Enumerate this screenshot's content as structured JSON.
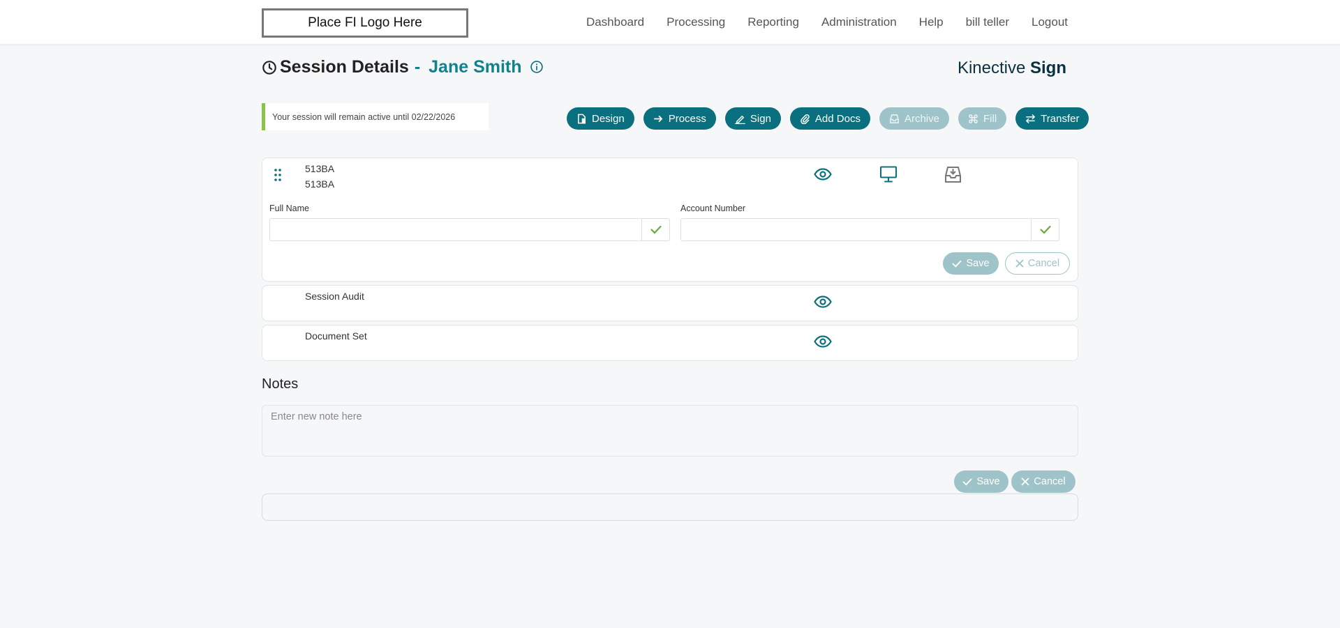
{
  "header": {
    "logo_text": "Place FI Logo Here",
    "nav": [
      "Dashboard",
      "Processing",
      "Reporting",
      "Administration",
      "Help",
      "bill teller",
      "Logout"
    ]
  },
  "title": {
    "label": "Session Details",
    "dash": "-",
    "name": "Jane Smith"
  },
  "brand": {
    "regular": "Kinective",
    "bold": "Sign"
  },
  "session_notice": "Your session will remain active until 02/22/2026",
  "actions": [
    {
      "label": "Design",
      "icon": "document-icon",
      "enabled": true
    },
    {
      "label": "Process",
      "icon": "arrow-right-icon",
      "enabled": true
    },
    {
      "label": "Sign",
      "icon": "pen-icon",
      "enabled": true
    },
    {
      "label": "Add Docs",
      "icon": "paperclip-icon",
      "enabled": true
    },
    {
      "label": "Archive",
      "icon": "archive-icon",
      "enabled": false
    },
    {
      "label": "Fill",
      "icon": "command-icon",
      "enabled": false
    },
    {
      "label": "Transfer",
      "icon": "transfer-icon",
      "enabled": true
    }
  ],
  "documents": {
    "main": {
      "line1": "513BA",
      "line2": "513BA",
      "full_name_label": "Full Name",
      "account_number_label": "Account Number",
      "save": "Save",
      "cancel": "Cancel"
    },
    "audit": {
      "label": "Session Audit"
    },
    "set": {
      "label": "Document Set"
    }
  },
  "notes": {
    "title": "Notes",
    "placeholder": "Enter new note here",
    "save": "Save",
    "cancel": "Cancel"
  },
  "colors": {
    "accent": "#0a6f7e",
    "disabled": "#9ec3c9",
    "success": "#8bc34a"
  }
}
